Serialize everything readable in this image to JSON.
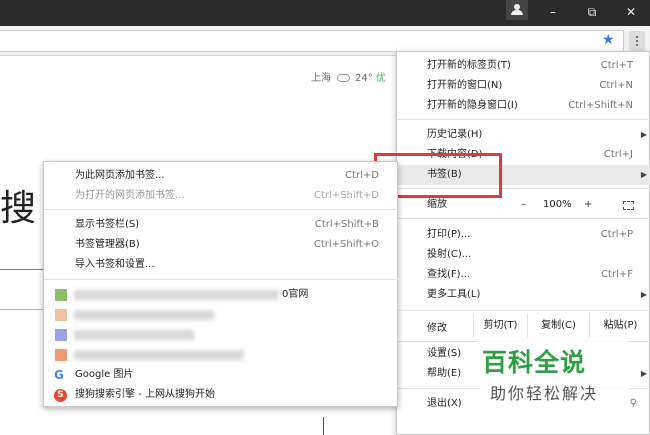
{
  "window": {
    "minimize": "–",
    "restore": "⧉",
    "close": "✕"
  },
  "page": {
    "weather_city": "上海",
    "weather_temp": "24°",
    "weather_quality": "优",
    "title_partial": "搜"
  },
  "main_menu": {
    "new_tab": {
      "label": "打开新的标签页(T)",
      "shortcut": "Ctrl+T"
    },
    "new_window": {
      "label": "打开新的窗口(N)",
      "shortcut": "Ctrl+N"
    },
    "new_incognito": {
      "label": "打开新的隐身窗口(I)",
      "shortcut": "Ctrl+Shift+N"
    },
    "history": {
      "label": "历史记录(H)"
    },
    "downloads": {
      "label": "下载内容(D)",
      "shortcut": "Ctrl+J"
    },
    "bookmarks": {
      "label": "书签(B)"
    },
    "zoom": {
      "label": "缩放",
      "minus": "–",
      "value": "100%",
      "plus": "+"
    },
    "print": {
      "label": "打印(P)...",
      "shortcut": "Ctrl+P"
    },
    "cast": {
      "label": "投射(C)..."
    },
    "find": {
      "label": "查找(F)...",
      "shortcut": "Ctrl+F"
    },
    "more_tools": {
      "label": "更多工具(L)"
    },
    "edit": {
      "label": "修改",
      "cut": "剪切(T)",
      "copy": "复制(C)",
      "paste": "粘贴(P)"
    },
    "settings": {
      "label": "设置(S)"
    },
    "help": {
      "label": "帮助(E)"
    },
    "exit": {
      "label": "退出(X)"
    }
  },
  "bookmark_menu": {
    "add_page": {
      "label": "为此网页添加书签...",
      "shortcut": "Ctrl+D"
    },
    "add_open_pages": {
      "label": "为打开的网页添加书签...",
      "shortcut": "Ctrl+Shift+D"
    },
    "show_bar": {
      "label": "显示书签栏(S)",
      "shortcut": "Ctrl+Shift+B"
    },
    "manager": {
      "label": "书签管理器(B)",
      "shortcut": "Ctrl+Shift+O"
    },
    "import": {
      "label": "导入书签和设置..."
    },
    "bookmark1_visible": "0官网",
    "google_images": "Google 图片",
    "sogou": "搜狗搜索引擎 - 上网从搜狗开始"
  },
  "watermark": {
    "title": "百科全说",
    "subtitle": "助你轻松解决"
  },
  "colors": {
    "highlight_border": "#e53935",
    "accent_star": "#3b78e7",
    "watermark_green": "#2ea043"
  }
}
